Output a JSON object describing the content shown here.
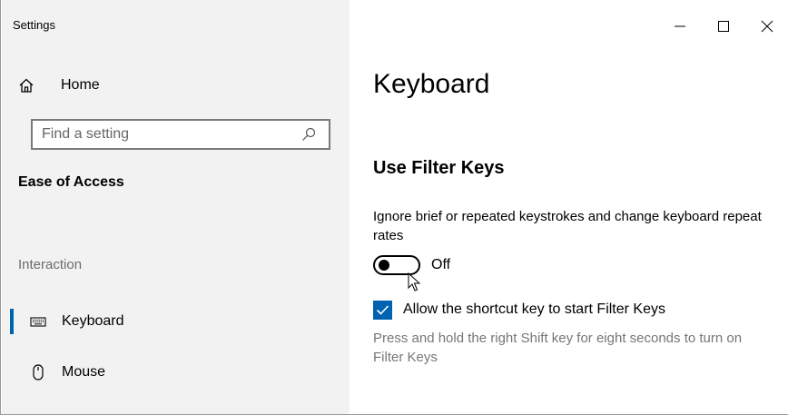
{
  "window": {
    "app_title": "Settings",
    "controls": [
      "minimize",
      "maximize",
      "close"
    ]
  },
  "sidebar": {
    "home_label": "Home",
    "search_placeholder": "Find a setting",
    "section_heading": "Ease of Access",
    "group_label": "Interaction",
    "items": [
      {
        "label": "Keyboard",
        "icon": "keyboard-icon",
        "selected": true
      },
      {
        "label": "Mouse",
        "icon": "mouse-icon",
        "selected": false
      }
    ]
  },
  "main": {
    "page_title": "Keyboard",
    "section_title": "Use Filter Keys",
    "description": "Ignore brief or repeated keystrokes and change keyboard repeat rates",
    "toggle_state": "Off",
    "checkbox_label": "Allow the shortcut key to start Filter Keys",
    "checkbox_checked": true,
    "hint": "Press and hold the right Shift key for eight seconds to turn on Filter Keys"
  },
  "colors": {
    "accent": "#0063b1",
    "sidebar_bg": "#f2f2f2",
    "hint_text": "#767676"
  }
}
